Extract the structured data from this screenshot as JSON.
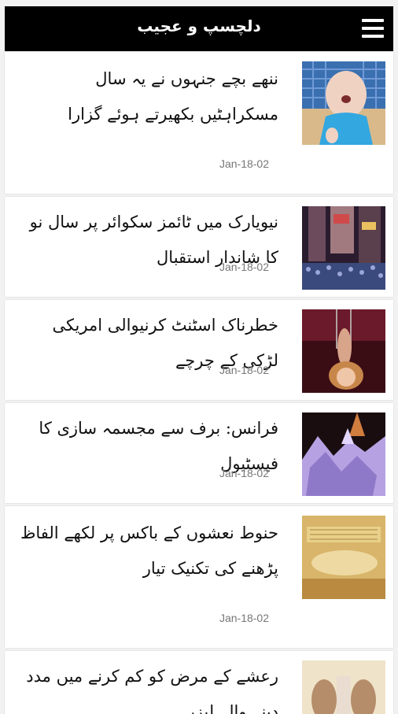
{
  "header": {
    "title": "دلچسپ و عجیب",
    "menu_icon": "hamburger-menu-icon"
  },
  "articles": [
    {
      "headline": "ننھے بچے جنہوں نے یہ سال مسکراہٹیں بکھیرتے ہوئے گزارا",
      "date": "Jan-18-02"
    },
    {
      "headline": "نیویارک میں ٹائمز سکوائر پر سال نو کا شاندار استقبال",
      "date": "Jan-18-02"
    },
    {
      "headline": "خطرناک اسٹنٹ کرنیوالی امریکی لڑکی کے چرچے",
      "date": "Jan-18-02"
    },
    {
      "headline": "فرانس: برف سے مجسمہ سازی کا فیسٹیول",
      "date": "Jan-18-02"
    },
    {
      "headline": "حنوط نعشوں کے باکس پر لکھے الفاظ پڑھنے کی تکنیک تیار",
      "date": "Jan-18-02"
    },
    {
      "headline": "رعشے کے مرض کو کم کرنے میں مدد دینے والے لیزر",
      "date": ""
    }
  ]
}
